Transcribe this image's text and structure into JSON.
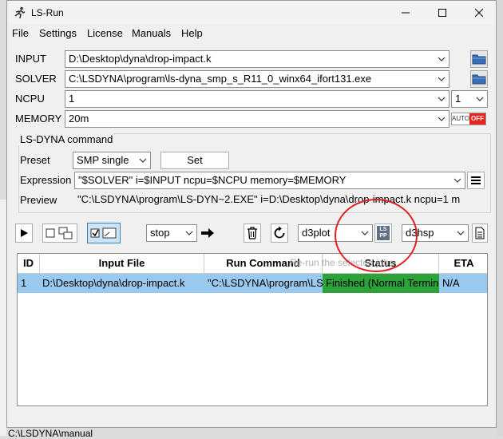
{
  "window": {
    "title": "LS-Run"
  },
  "menu": [
    "File",
    "Settings",
    "License",
    "Manuals",
    "Help"
  ],
  "fields": {
    "input_label": "INPUT",
    "input_value": "D:\\Desktop\\dyna\\drop-impact.k",
    "solver_label": "SOLVER",
    "solver_value": "C:\\LSDYNA\\program\\ls-dyna_smp_s_R11_0_winx64_ifort131.exe",
    "ncpu_label": "NCPU",
    "ncpu_value": "1",
    "ncpu_small_value": "1",
    "memory_label": "MEMORY",
    "memory_value": "20m",
    "auto_label": "AUTO",
    "off_label": "OFF"
  },
  "command": {
    "group_label": "LS-DYNA command",
    "preset_label": "Preset",
    "preset_value": "SMP single",
    "set_button": "Set",
    "expression_label": "Expression",
    "expression_value": "\"$SOLVER\" i=$INPUT ncpu=$NCPU memory=$MEMORY",
    "preview_label": "Preview",
    "preview_value": "\"C:\\LSDYNA\\program\\LS-DYN~2.EXE\" i=D:\\Desktop\\dyna\\drop-impact.k ncpu=1 m"
  },
  "toolbar": {
    "stop_value": "stop",
    "d3plot_value": "d3plot",
    "d3hsp_value": "d3hsp",
    "lspp_label": "LS\nPP"
  },
  "table": {
    "headers": [
      "ID",
      "Input File",
      "Run Command",
      "Status",
      "ETA"
    ],
    "rows": [
      {
        "id": "1",
        "input": "D:\\Desktop\\dyna\\drop-impact.k",
        "command": "\"C:\\LSDYNA\\program\\LS-",
        "status": "Finished (Normal Termin",
        "eta": "N/A"
      }
    ],
    "tooltip": "Re-run the selected jobs"
  },
  "background": {
    "bottom_text": "C:\\LSDYNA\\manual"
  },
  "colors": {
    "selected_row": "#99c9ef",
    "status_green": "#2ea23a",
    "off_red": "#e8231b",
    "annotation_red": "#e02020"
  }
}
